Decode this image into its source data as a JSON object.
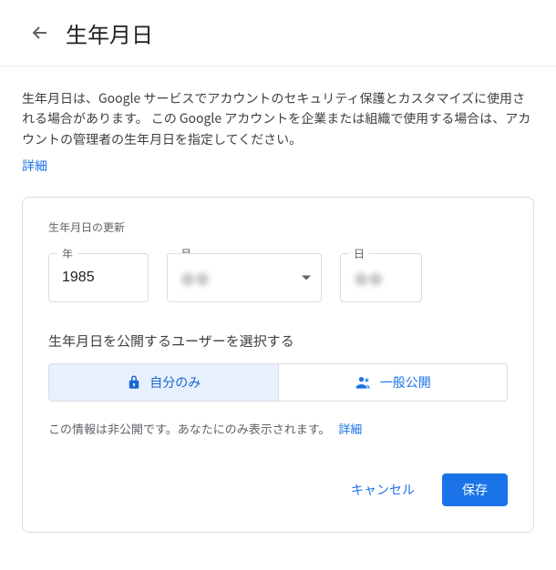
{
  "header": {
    "title": "生年月日"
  },
  "description": "生年月日は、Google サービスでアカウントのセキュリティ保護とカスタマイズに使用される場合があります。 この Google アカウントを企業または組織で使用する場合は、アカウントの管理者の生年月日を指定してください。",
  "learn_more": "詳細",
  "card": {
    "subtitle": "生年月日の更新",
    "fields": {
      "year": {
        "label": "年",
        "value": "1985"
      },
      "month": {
        "label": "月",
        "value": ""
      },
      "day": {
        "label": "日",
        "value": ""
      }
    },
    "visibility_heading": "生年月日を公開するユーザーを選択する",
    "visibility": {
      "private": "自分のみ",
      "public": "一般公開"
    },
    "privacy_note": "この情報は非公開です。あなたにのみ表示されます。",
    "actions": {
      "cancel": "キャンセル",
      "save": "保存"
    }
  }
}
